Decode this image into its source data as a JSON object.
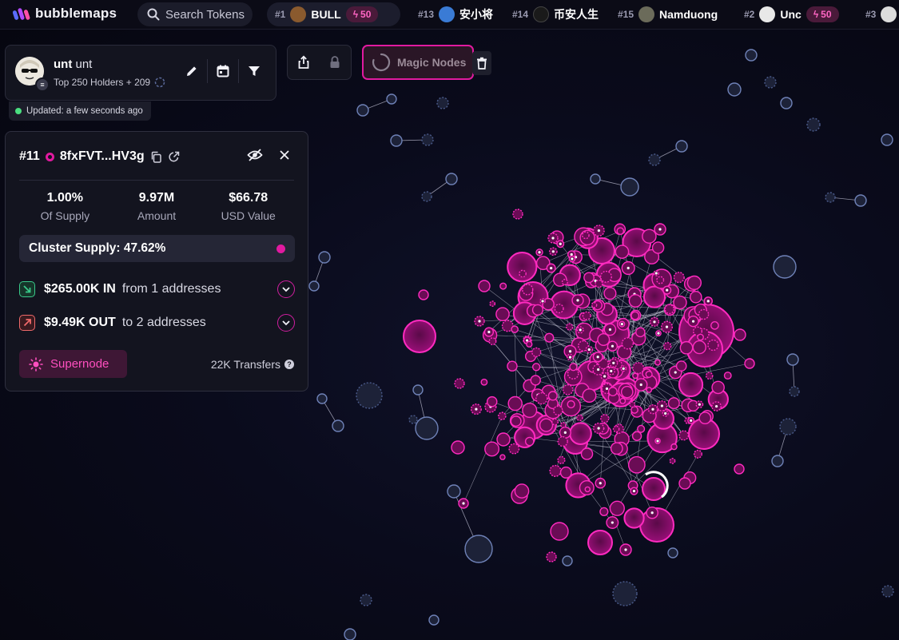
{
  "brand": {
    "name": "bubblemaps"
  },
  "search": {
    "placeholder": "Search Tokens"
  },
  "trending": [
    {
      "rank": "#1",
      "name": "BULL",
      "boost": "50",
      "avatar_color": "#8a5a2e"
    },
    {
      "rank": "#13",
      "name": "安小将",
      "avatar_color": "#3a7bd5"
    },
    {
      "rank": "#14",
      "name": "币安人生",
      "avatar_color": "#1a1a1a"
    },
    {
      "rank": "#15",
      "name": "Namduong",
      "avatar_color": "#6b6b5a"
    },
    {
      "rank": "#2",
      "name": "Unc",
      "boost": "50",
      "avatar_color": "#e8e8e8"
    },
    {
      "rank": "#3",
      "name": "",
      "avatar_color": "#dcdcdc"
    }
  ],
  "token": {
    "symbol": "unt",
    "name": "unt",
    "subtitle": "Top 250 Holders + 209",
    "updated": "Updated: a few seconds ago"
  },
  "magic_nodes": {
    "label": "Magic Nodes"
  },
  "wallet": {
    "rank": "#11",
    "address": "8fxFVT...HV3g",
    "stats": [
      {
        "value": "1.00%",
        "label": "Of Supply"
      },
      {
        "value": "9.97M",
        "label": "Amount"
      },
      {
        "value": "$66.78",
        "label": "USD Value"
      }
    ],
    "cluster_supply": "Cluster Supply: 47.62%",
    "inflow": {
      "amount": "$265.00K IN",
      "detail": "from 1 addresses"
    },
    "outflow": {
      "amount": "$9.49K OUT",
      "detail": "to 2 addresses"
    },
    "supernode_label": "Supernode",
    "transfers": "22K Transfers"
  },
  "colors": {
    "accent": "#e11aa0",
    "inflow": "#39c98a",
    "outflow": "#f06a6a",
    "node_blue": "#2b3352"
  }
}
